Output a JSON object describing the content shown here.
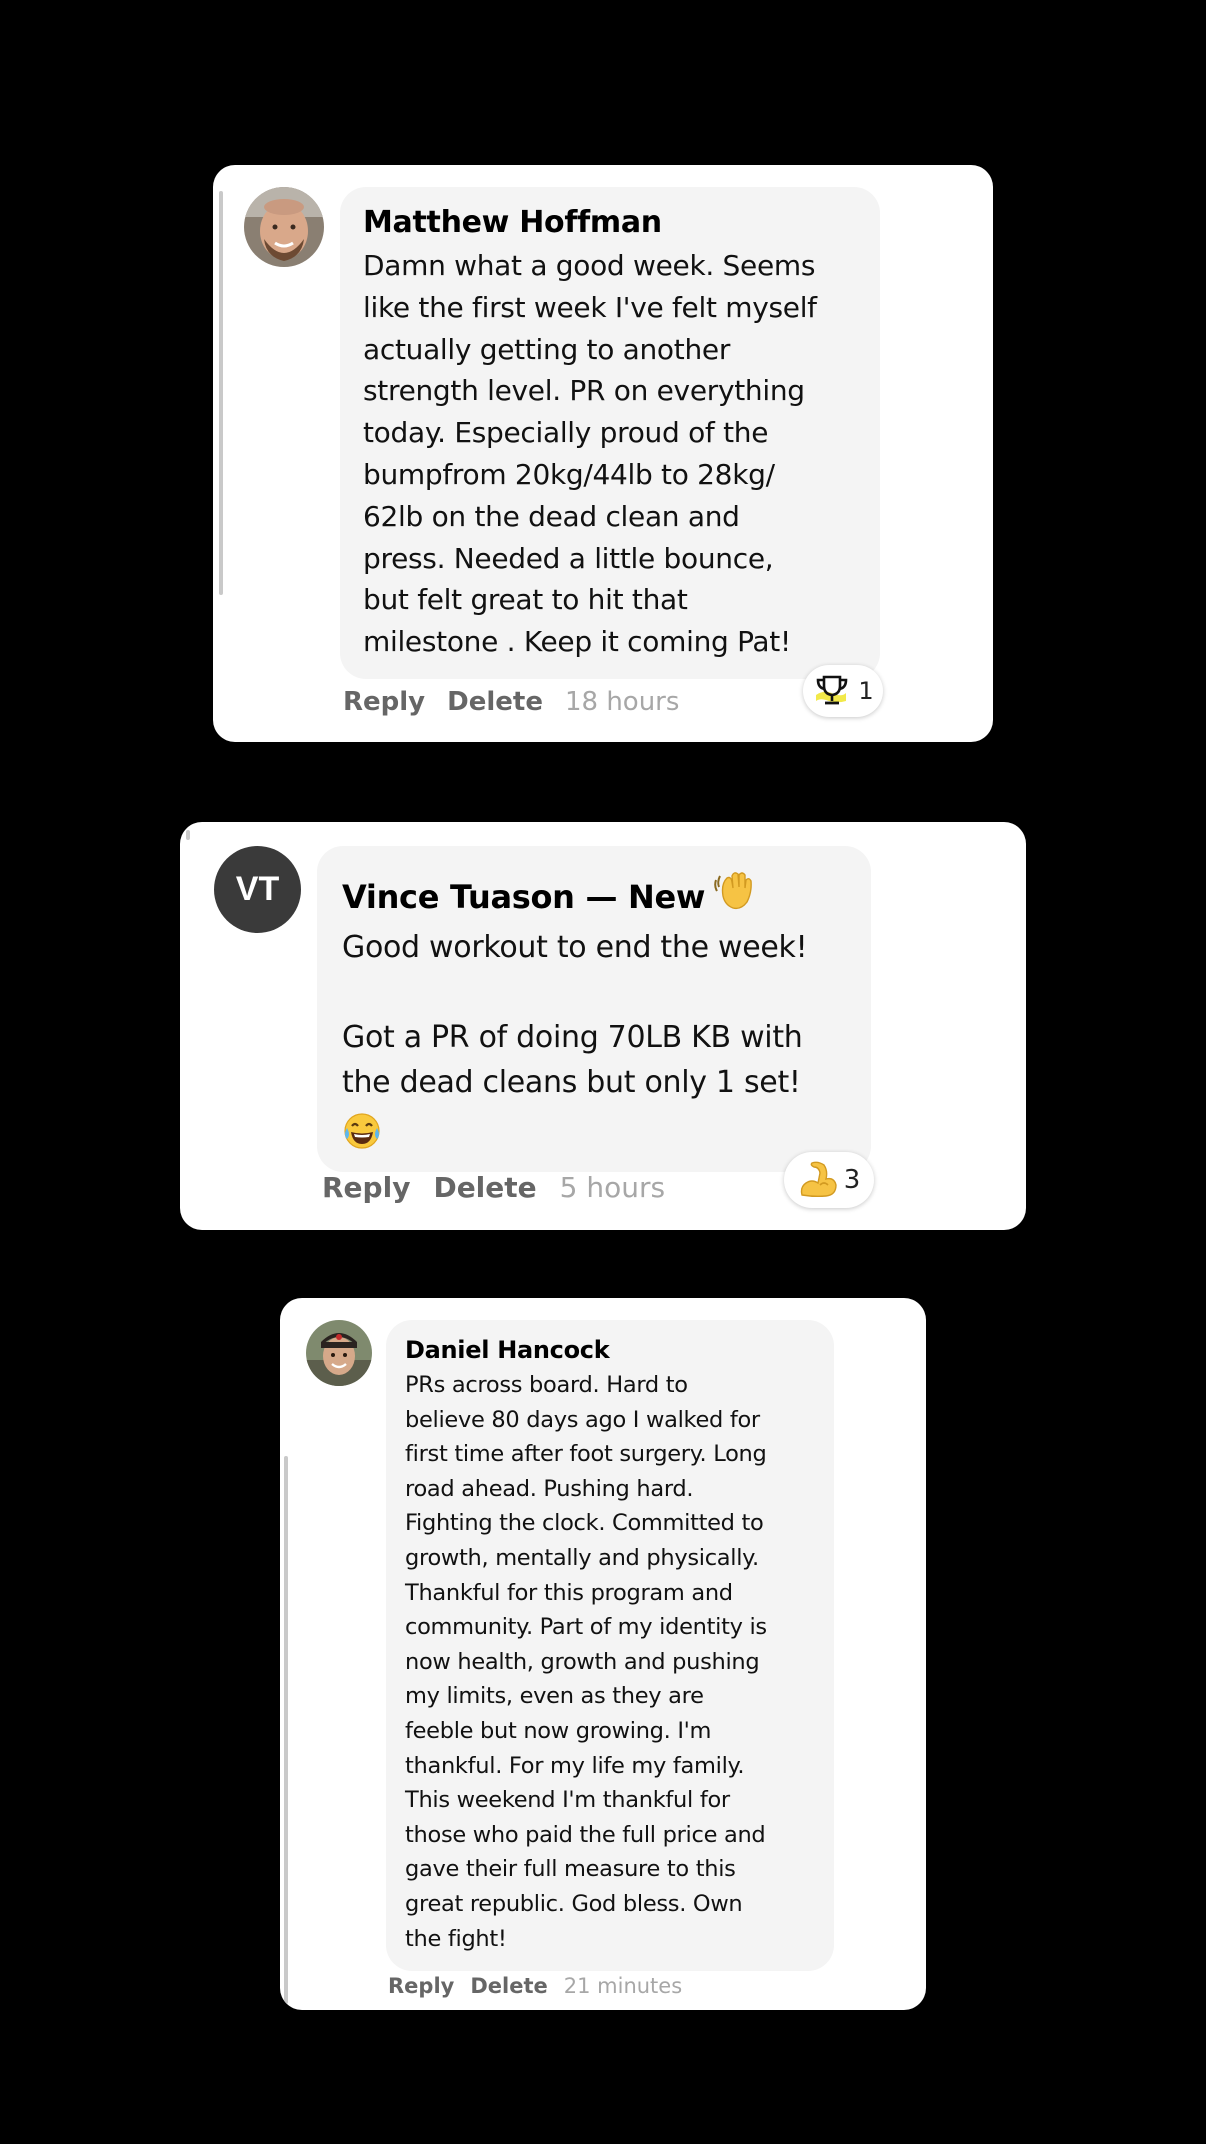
{
  "comments": [
    {
      "author": "Matthew Hoffman",
      "text": "Damn what a good week. Seems\nlike the first week I've felt myself\nactually getting to another\nstrength level. PR on everything\ntoday. Especially proud of the\nbumpfrom 20kg/44lb to 28kg/\n62lb on the dead clean and\npress. Needed a little bounce,\nbut felt great to hit that\nmilestone . Keep it coming Pat!",
      "reply_label": "Reply",
      "delete_label": "Delete",
      "timestamp": "18 hours",
      "reaction_icon": "trophy-icon",
      "reaction_count": "1"
    },
    {
      "author": "Vince Tuason — New",
      "author_badge_icon": "waving-hand-icon",
      "avatar_initials": "VT",
      "text": "Good workout to end the week!\n\nGot a PR of doing 70LB KB with\nthe dead cleans but only 1 set!",
      "text_emoji_icon": "tears-of-joy-icon",
      "reply_label": "Reply",
      "delete_label": "Delete",
      "timestamp": "5 hours",
      "reaction_icon": "flexed-biceps-icon",
      "reaction_count": "3"
    },
    {
      "author": "Daniel Hancock",
      "text": "PRs across board. Hard to\nbelieve 80 days ago I walked for\nfirst time after foot surgery. Long\nroad ahead. Pushing hard.\nFighting the clock. Committed to\ngrowth, mentally and physically.\nThankful for this program and\ncommunity. Part of my identity is\nnow health, growth and pushing\nmy limits, even as they are\nfeeble but now growing. I'm\nthankful. For my life my family.\nThis weekend I'm thankful for\nthose who paid the full price and\ngave their full measure to this\ngreat republic. God bless. Own\nthe fight!",
      "reply_label": "Reply",
      "delete_label": "Delete",
      "timestamp": "21 minutes"
    }
  ],
  "colors": {
    "background": "#000000",
    "card": "#ffffff",
    "bubble": "#f4f4f4",
    "action": "#666666",
    "timestamp": "#a7a7a7",
    "initials_avatar": "#3a3a3a"
  }
}
